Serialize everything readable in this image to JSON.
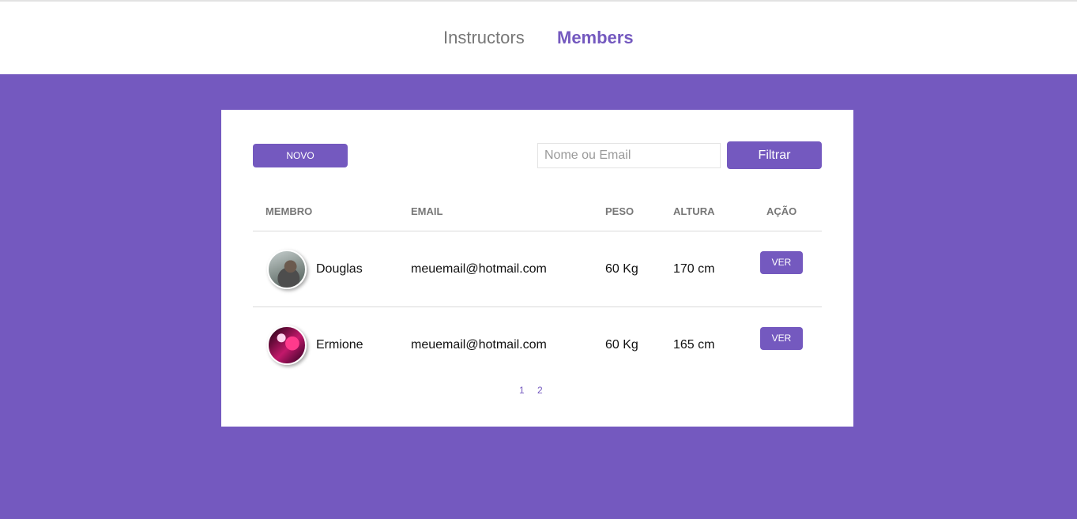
{
  "nav": {
    "instructors_label": "Instructors",
    "members_label": "Members"
  },
  "toolbar": {
    "new_label": "NOVO",
    "search_placeholder": "Nome ou Email",
    "search_value": "",
    "filter_label": "Filtrar"
  },
  "table": {
    "columns": [
      "MEMBRO",
      "EMAIL",
      "PESO",
      "ALTURA",
      "AÇÃO"
    ],
    "rows": [
      {
        "name": "Douglas",
        "email": "meuemail@hotmail.com",
        "weight": "60 Kg",
        "height": "170 cm",
        "action_label": "VER"
      },
      {
        "name": "Ermione",
        "email": "meuemail@hotmail.com",
        "weight": "60 Kg",
        "height": "165 cm",
        "action_label": "VER"
      }
    ]
  },
  "pagination": {
    "pages": [
      "1",
      "2"
    ]
  },
  "colors": {
    "brand": "#7459bf",
    "header_bg": "#ffffff",
    "muted_text": "#777777"
  }
}
